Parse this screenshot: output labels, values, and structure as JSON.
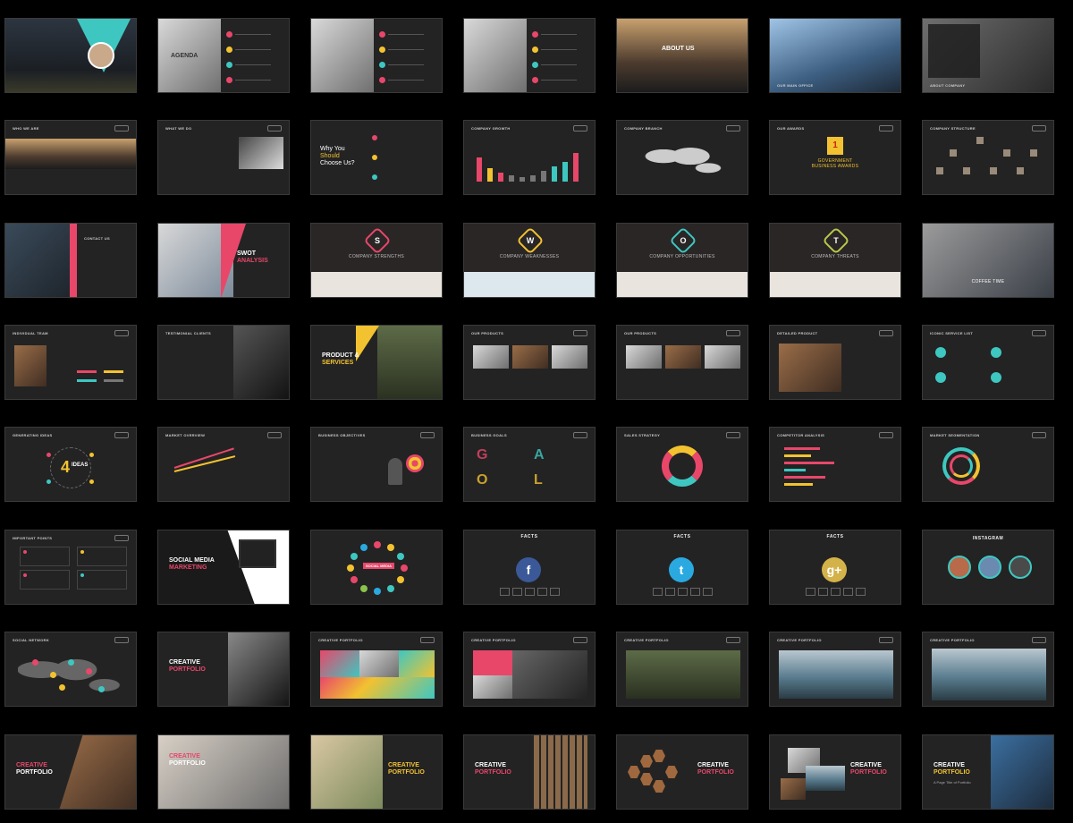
{
  "grid": {
    "slides": [
      {
        "id": "s1",
        "style": "title-avatar"
      },
      {
        "id": "s2",
        "style": "agenda",
        "text": "AGENDA"
      },
      {
        "id": "s3",
        "style": "agenda-plain"
      },
      {
        "id": "s4",
        "style": "agenda-plain"
      },
      {
        "id": "s5",
        "style": "about-street",
        "text": "ABOUT US"
      },
      {
        "id": "s6",
        "style": "building",
        "text": "OUR MAIN OFFICE"
      },
      {
        "id": "s7",
        "style": "desk",
        "text": "ABOUT COMPANY"
      },
      {
        "id": "s8",
        "style": "who-we-are",
        "text": "WHO WE ARE"
      },
      {
        "id": "s9",
        "style": "what-we-do",
        "text": "WHAT WE DO"
      },
      {
        "id": "s10",
        "style": "why-choose",
        "line1": "Why You",
        "line2_a": "Should",
        "line2_b": "Choose Us?"
      },
      {
        "id": "s11",
        "style": "company-growth",
        "text": "COMPANY GROWTH",
        "bars": [
          0.55,
          0.3,
          0.2,
          0.15,
          0.1,
          0.15,
          0.25,
          0.35,
          0.45,
          0.65
        ],
        "bar_colors": [
          "#e8476a",
          "#f2c230",
          "#e8476a",
          "#777",
          "#777",
          "#777",
          "#777",
          "#3ec7c1",
          "#3ec7c1",
          "#e8476a"
        ]
      },
      {
        "id": "s12",
        "style": "company-branch",
        "text": "COMPANY BRANCH"
      },
      {
        "id": "s13",
        "style": "award",
        "text": "OUR AWARDS",
        "badge": "1",
        "line1": "GOVERNMENT",
        "line2": "BUSINESS AWARDS"
      },
      {
        "id": "s14",
        "style": "structure",
        "text": "COMPANY STRUCTURE"
      },
      {
        "id": "s15",
        "style": "contact",
        "text": "CONTACT US"
      },
      {
        "id": "s16",
        "style": "swot",
        "line1": "SWOT",
        "line2": "ANALYSIS"
      },
      {
        "id": "s17",
        "style": "swot-letter",
        "letter": "S",
        "caption": "COMPANY STRENGTHS",
        "color": "#e8476a",
        "strip": "#e9e4de"
      },
      {
        "id": "s18",
        "style": "swot-letter",
        "letter": "W",
        "caption": "COMPANY WEAKNESSES",
        "color": "#f2c230",
        "strip": "#dce8ee"
      },
      {
        "id": "s19",
        "style": "swot-letter",
        "letter": "O",
        "caption": "COMPANY OPPORTUNITIES",
        "color": "#3ec7c1",
        "strip": "#e9e4de"
      },
      {
        "id": "s20",
        "style": "swot-letter",
        "letter": "T",
        "caption": "COMPANY THREATS",
        "color": "#b8c94a",
        "strip": "#e9e4de"
      },
      {
        "id": "s21",
        "style": "coffee",
        "text": "COFFEE TIME"
      },
      {
        "id": "s22",
        "style": "team",
        "text": "INDIVIDUAL TEAM"
      },
      {
        "id": "s23",
        "style": "clients",
        "text": "TESTIMONIAL CLIENTS"
      },
      {
        "id": "s24",
        "style": "product",
        "line1": "PRODUCT &",
        "line2": "SERVICES"
      },
      {
        "id": "s25",
        "style": "products-grid",
        "text": "OUR PRODUCTS"
      },
      {
        "id": "s26",
        "style": "products-grid2",
        "text": "OUR PRODUCTS"
      },
      {
        "id": "s27",
        "style": "detailed-product",
        "text": "DETAILED PRODUCT"
      },
      {
        "id": "s28",
        "style": "service-list",
        "text": "ICONIC SERVICE LIST"
      },
      {
        "id": "s29",
        "style": "ideas",
        "text": "GENERATING IDEAS",
        "num": "4",
        "label": "IDEAS"
      },
      {
        "id": "s30",
        "style": "market-overview",
        "text": "MARKET OVERVIEW"
      },
      {
        "id": "s31",
        "style": "objectives",
        "text": "BUSINESS OBJECTIVES"
      },
      {
        "id": "s32",
        "style": "goals",
        "text": "BUSINESS GOALS",
        "letters": [
          "G",
          "O",
          "A",
          "L"
        ]
      },
      {
        "id": "s33",
        "style": "sales",
        "text": "SALES STRATEGY"
      },
      {
        "id": "s34",
        "style": "competitor",
        "text": "COMPETITOR ANALYSIS"
      },
      {
        "id": "s35",
        "style": "segmentation",
        "text": "MARKET SEGMENTATION"
      },
      {
        "id": "s36",
        "style": "important-points",
        "text": "IMPORTANT POINTS"
      },
      {
        "id": "s37",
        "style": "social-media",
        "line1": "SOCIAL MEDIA",
        "line2": "MARKETING"
      },
      {
        "id": "s38",
        "style": "social-cloud",
        "text": "SOCIAL MEDIA"
      },
      {
        "id": "s39",
        "style": "facts",
        "title": "FACTS",
        "icon": "f",
        "color": "#3b5998"
      },
      {
        "id": "s40",
        "style": "facts",
        "title": "FACTS",
        "icon": "t",
        "color": "#2aa9e0"
      },
      {
        "id": "s41",
        "style": "facts",
        "title": "FACTS",
        "icon": "g+",
        "color": "#d4b24a"
      },
      {
        "id": "s42",
        "style": "instagram",
        "title": "INSTAGRAM"
      },
      {
        "id": "s43",
        "style": "social-network",
        "text": "SOCIAL NETWORK"
      },
      {
        "id": "s44",
        "style": "creative-portfolio-a",
        "line1": "CREATIVE",
        "line2": "PORTFOLIO"
      },
      {
        "id": "s45",
        "style": "portfolio-grid",
        "text": "CREATIVE PORTFOLIO"
      },
      {
        "id": "s46",
        "style": "portfolio-grid2",
        "text": "CREATIVE PORTFOLIO"
      },
      {
        "id": "s47",
        "style": "portfolio-wide",
        "text": "CREATIVE PORTFOLIO"
      },
      {
        "id": "s48",
        "style": "portfolio-wide2",
        "text": "CREATIVE PORTFOLIO"
      },
      {
        "id": "s49",
        "style": "portfolio-wide3",
        "text": "CREATIVE PORTFOLIO"
      },
      {
        "id": "s50",
        "style": "cp-woman",
        "line1": "CREATIVE",
        "line2": "PORTFOLIO"
      },
      {
        "id": "s51",
        "style": "cp-bike",
        "line1": "CREATIVE",
        "line2": "PORTFOLIO"
      },
      {
        "id": "s52",
        "style": "cp-girl",
        "line1": "CREATIVE",
        "line2": "PORTFOLIO"
      },
      {
        "id": "s53",
        "style": "cp-stripes",
        "line1": "CREATIVE",
        "line2": "PORTFOLIO"
      },
      {
        "id": "s54",
        "style": "cp-hex",
        "line1": "CREATIVE",
        "line2": "PORTFOLIO"
      },
      {
        "id": "s55",
        "style": "cp-collage",
        "line1": "CREATIVE",
        "line2": "PORTFOLIO"
      },
      {
        "id": "s56",
        "style": "cp-camera",
        "line1": "CREATIVE",
        "line2": "PORTFOLIO",
        "sub": "A Page Title of Portfolio"
      }
    ]
  },
  "colors": {
    "pink": "#e8476a",
    "yellow": "#f2c230",
    "teal": "#3ec7c1",
    "slide_bg": "#232323"
  }
}
